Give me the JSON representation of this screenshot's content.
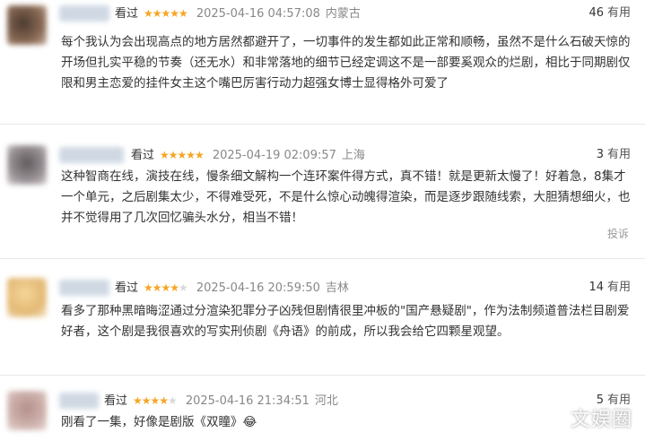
{
  "reviews": [
    {
      "label": "看过",
      "stars": 5,
      "time": "2025-04-16 04:57:08",
      "location": "内蒙古",
      "useful_count": "46",
      "useful_label": "有用",
      "text": "每个我认为会出现高点的地方居然都避开了，一切事件的发生都如此正常和顺畅，虽然不是什么石破天惊的开场但扎实平稳的节奏（还无水）和非常落地的细节已经定调这不是一部要奚观众的烂剧，相比于同期剧仅限和男主恋爱的挂件女主这个嘴巴厉害行动力超强女博士显得格外可爱了",
      "avatar_color": "#6b5040"
    },
    {
      "label": "看过",
      "stars": 5,
      "time": "2025-04-19 02:09:57",
      "location": "上海",
      "useful_count": "3",
      "useful_label": "有用",
      "text": "这种智商在线，演技在线，慢条细文解构一个连环案件得方式，真不错！就是更新太慢了！好着急，8集才一个单元，之后剧集太少，不得难受死，不是什么惊心动魄得渲染，而是逐步跟随线索，大胆猜想细火，也并不觉得用了几次回忆骗头水分，相当不错！",
      "report": "投诉",
      "avatar_color": "#7a7276"
    },
    {
      "label": "看过",
      "stars": 4,
      "time": "2025-04-16 20:59:50",
      "location": "吉林",
      "useful_count": "14",
      "useful_label": "有用",
      "text": "看多了那种黑暗晦涩通过分渲染犯罪分子凶残但剧情很里冲板的\"国产悬疑剧\"，作为法制频道普法栏目剧爱好者，这个剧是我很喜欢的写实刑侦剧《舟语》的前成，所以我会给它四颗星观望。",
      "avatar_color": "#e8c48a"
    },
    {
      "label": "看过",
      "stars": 4,
      "time": "2025-04-16 21:34:51",
      "location": "河北",
      "useful_count": "5",
      "useful_label": "有用",
      "text": "刚看了一集，好像是剧版《双瞳》😂",
      "avatar_color": "#c9a9a5"
    }
  ],
  "watermark": "文娱圈"
}
